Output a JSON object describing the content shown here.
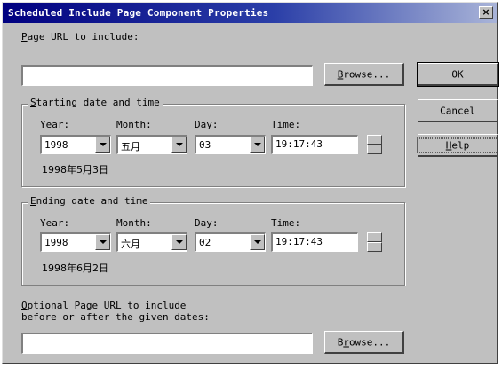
{
  "window": {
    "title": "Scheduled Include Page Component Properties",
    "close_glyph": "×"
  },
  "page_url": {
    "label_u": "P",
    "label_rest": "age URL to include:",
    "value": ""
  },
  "browse_button": {
    "label_u": "B",
    "label_rest": "rowse..."
  },
  "buttons": {
    "ok": "OK",
    "cancel": "Cancel",
    "help_u": "H",
    "help_rest": "elp"
  },
  "starting": {
    "legend_u": "S",
    "legend_rest": "tarting date and time",
    "year_label": "Year:",
    "month_label": "Month:",
    "day_label": "Day:",
    "time_label": "Time:",
    "year": "1998",
    "month": "五月",
    "day": "03",
    "time": "19:17:43",
    "date_text": "1998年5月3日"
  },
  "ending": {
    "legend_u": "E",
    "legend_rest": "nding date and time",
    "year_label": "Year:",
    "month_label": "Month:",
    "day_label": "Day:",
    "time_label": "Time:",
    "year": "1998",
    "month": "六月",
    "day": "02",
    "time": "19:17:43",
    "date_text": "1998年6月2日"
  },
  "optional": {
    "label_u": "O",
    "label_line1_rest": "ptional Page URL to include",
    "label_line2": "before or after the given dates:",
    "value": "",
    "browse_u": "r",
    "browse_pre": "B",
    "browse_post": "owse..."
  }
}
